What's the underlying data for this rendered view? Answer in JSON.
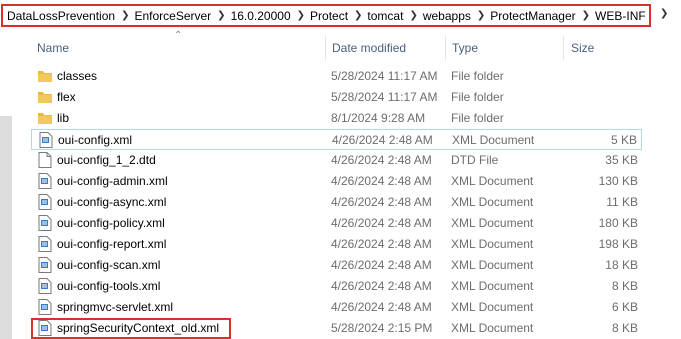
{
  "breadcrumb": {
    "items": [
      "DataLossPrevention",
      "EnforceServer",
      "16.0.20000",
      "Protect",
      "tomcat",
      "webapps",
      "ProtectManager",
      "WEB-INF"
    ]
  },
  "columns": {
    "name": "Name",
    "date": "Date modified",
    "type": "Type",
    "size": "Size"
  },
  "files": [
    {
      "name": "classes",
      "date": "5/28/2024 11:17 AM",
      "type": "File folder",
      "size": "",
      "icon": "folder-icon"
    },
    {
      "name": "flex",
      "date": "5/28/2024 11:17 AM",
      "type": "File folder",
      "size": "",
      "icon": "folder-icon"
    },
    {
      "name": "lib",
      "date": "8/1/2024 9:28 AM",
      "type": "File folder",
      "size": "",
      "icon": "folder-icon"
    },
    {
      "name": "oui-config.xml",
      "date": "4/26/2024 2:48 AM",
      "type": "XML Document",
      "size": "5 KB",
      "icon": "xml-file-icon"
    },
    {
      "name": "oui-config_1_2.dtd",
      "date": "4/26/2024 2:48 AM",
      "type": "DTD File",
      "size": "35 KB",
      "icon": "file-icon"
    },
    {
      "name": "oui-config-admin.xml",
      "date": "4/26/2024 2:48 AM",
      "type": "XML Document",
      "size": "130 KB",
      "icon": "xml-file-icon"
    },
    {
      "name": "oui-config-async.xml",
      "date": "4/26/2024 2:48 AM",
      "type": "XML Document",
      "size": "11 KB",
      "icon": "xml-file-icon"
    },
    {
      "name": "oui-config-policy.xml",
      "date": "4/26/2024 2:48 AM",
      "type": "XML Document",
      "size": "180 KB",
      "icon": "xml-file-icon"
    },
    {
      "name": "oui-config-report.xml",
      "date": "4/26/2024 2:48 AM",
      "type": "XML Document",
      "size": "198 KB",
      "icon": "xml-file-icon"
    },
    {
      "name": "oui-config-scan.xml",
      "date": "4/26/2024 2:48 AM",
      "type": "XML Document",
      "size": "18 KB",
      "icon": "xml-file-icon"
    },
    {
      "name": "oui-config-tools.xml",
      "date": "4/26/2024 2:48 AM",
      "type": "XML Document",
      "size": "8 KB",
      "icon": "xml-file-icon"
    },
    {
      "name": "springmvc-servlet.xml",
      "date": "4/26/2024 2:48 AM",
      "type": "XML Document",
      "size": "6 KB",
      "icon": "xml-file-icon"
    },
    {
      "name": "springSecurityContext_old.xml",
      "date": "5/28/2024 2:15 PM",
      "type": "XML Document",
      "size": "8 KB",
      "icon": "xml-file-icon"
    }
  ],
  "colors": {
    "highlight": "#d9302c",
    "selection_border": "#b6d5ec",
    "folder": "#e8b84a",
    "header_text": "#4c607a"
  }
}
